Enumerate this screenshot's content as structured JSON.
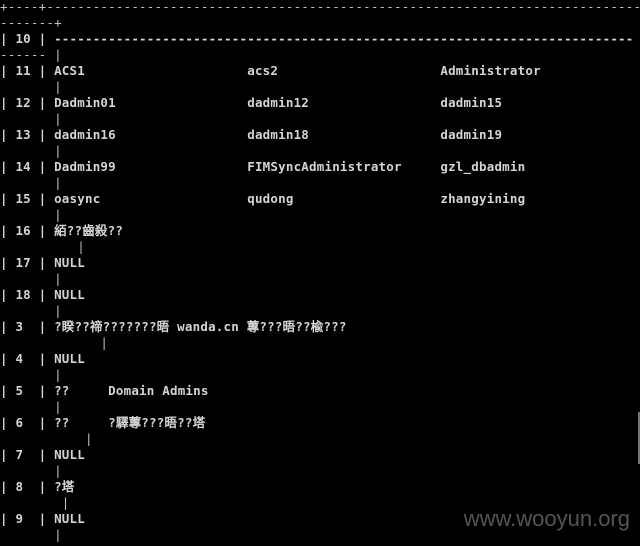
{
  "console": {
    "lines": [
      "+----+-----------------------------------------------------------------------------",
      "-------+",
      "| 10 | ---------------------------------------------------------------------------",
      "------ |",
      "| 11 | ACS1                     acs2                     Administrator",
      "       |",
      "| 12 | Dadmin01                 dadmin12                 dadmin15",
      "       |",
      "| 13 | dadmin16                 dadmin18                 dadmin19",
      "       |",
      "| 14 | Dadmin99                 FIMSyncAdministrator     gzl_dbadmin",
      "       |",
      "| 15 | oasync                   qudong                   zhangyining",
      "       |",
      "| 16 | 絔??齒殺??",
      "          |",
      "| 17 | NULL",
      "       |",
      "| 18 | NULL",
      "       |",
      "| 3  | ?睽??禘???????晤 wanda.cn 蓴???晤??楡???",
      "             |",
      "| 4  | NULL",
      "       |",
      "| 5  | ??     Domain Admins",
      "       |",
      "| 6  | ??     ?驛蓴???晤??塔",
      "           |",
      "| 7  | NULL",
      "       |",
      "| 8  | ?塔",
      "        |",
      "| 9  | NULL",
      "       |"
    ]
  },
  "watermark": "www.wooyun.org"
}
